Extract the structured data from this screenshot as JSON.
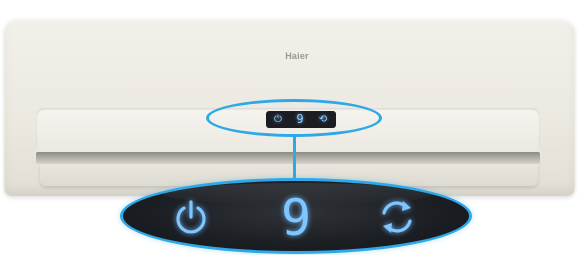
{
  "brand": {
    "logo_text": "Haier"
  },
  "display": {
    "digit": "9",
    "left_icon": "power-icon",
    "right_icon": "refresh-cycle-icon",
    "glow_color": "#7fc6ff"
  },
  "highlight": {
    "color": "#2ea8e6"
  }
}
